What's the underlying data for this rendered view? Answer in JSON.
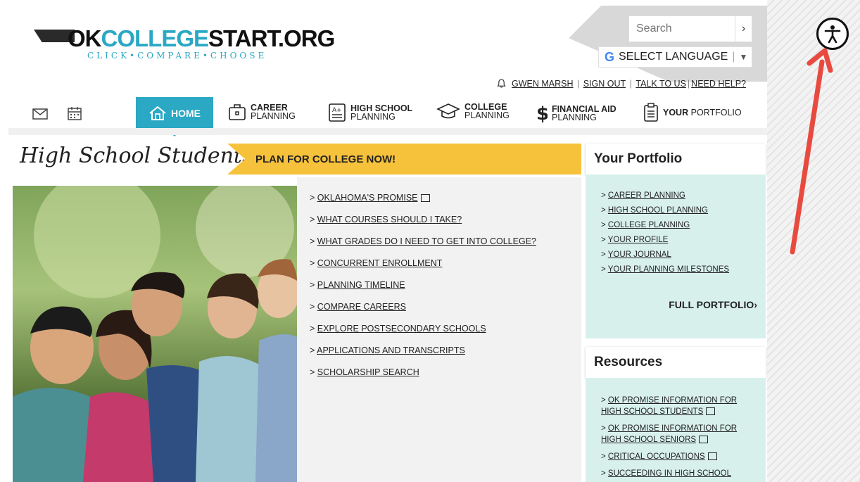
{
  "logo": {
    "part1": "OK",
    "part2": "COLLEGE",
    "part3": "START.ORG",
    "tagline": "CLICK•COMPARE•CHOOSE"
  },
  "search": {
    "placeholder": "Search",
    "button": "›"
  },
  "language": {
    "label": "SELECT LANGUAGE",
    "g": "G",
    "sep": "|",
    "arrow": "▼"
  },
  "user_links": {
    "user": "GWEN MARSH",
    "sign_out": "SIGN OUT",
    "talk": "TALK TO US",
    "help": "NEED HELP?",
    "pipe": "|"
  },
  "nav": {
    "home": "HOME",
    "career_bold": "CAREER",
    "career_rest": "PLANNING",
    "hs_bold": "HIGH SCHOOL",
    "hs_rest": "PLANNING",
    "college_bold": "COLLEGE",
    "college_rest": "PLANNING",
    "fin_bold": "FINANCIAL AID",
    "fin_rest": "PLANNING",
    "your_bold": "YOUR",
    "your_rest": "PORTFOLIO"
  },
  "hero": {
    "script_title": "High School Students",
    "banner": "PLAN FOR COLLEGE NOW!"
  },
  "links": [
    {
      "prefix": ">",
      "label": "OKLAHOMA'S PROMISE"
    },
    {
      "prefix": ">",
      "label": "WHAT COURSES SHOULD I TAKE?"
    },
    {
      "prefix": ">",
      "label": "WHAT GRADES DO I NEED TO GET INTO COLLEGE?"
    },
    {
      "prefix": ">",
      "label": "CONCURRENT ENROLLMENT"
    },
    {
      "prefix": ">",
      "label": "PLANNING TIMELINE"
    },
    {
      "prefix": ">",
      "label": "COMPARE CAREERS"
    },
    {
      "prefix": ">",
      "label": "EXPLORE POSTSECONDARY SCHOOLS"
    },
    {
      "prefix": ">",
      "label": "APPLICATIONS AND TRANSCRIPTS"
    },
    {
      "prefix": ">",
      "label": "SCHOLARSHIP SEARCH"
    }
  ],
  "portfolio": {
    "title": "Your Portfolio",
    "items": [
      {
        "prefix": ">",
        "label": "CAREER PLANNING"
      },
      {
        "prefix": ">",
        "label": "HIGH SCHOOL PLANNING"
      },
      {
        "prefix": ">",
        "label": "COLLEGE PLANNING"
      },
      {
        "prefix": ">",
        "label": "YOUR PROFILE"
      },
      {
        "prefix": ">",
        "label": "YOUR JOURNAL"
      },
      {
        "prefix": ">",
        "label": "YOUR PLANNING MILESTONES"
      }
    ],
    "full": "FULL PORTFOLIO",
    "full_arrow": "›"
  },
  "resources": {
    "title": "Resources",
    "items": [
      {
        "prefix": ">",
        "label": "OK PROMISE INFORMATION FOR HIGH SCHOOL STUDENTS"
      },
      {
        "prefix": ">",
        "label": "OK PROMISE INFORMATION FOR HIGH SCHOOL SENIORS"
      },
      {
        "prefix": ">",
        "label": "CRITICAL OCCUPATIONS"
      },
      {
        "prefix": ">",
        "label": "SUCCEEDING IN HIGH SCHOOL"
      }
    ]
  },
  "colors": {
    "teal": "#2aa8c4",
    "yellow": "#f7c23b",
    "mint": "#d8f0ec",
    "arrow": "#e84a3f"
  },
  "icons": {
    "mail": "mail-icon",
    "calendar": "calendar-icon",
    "home": "home-icon",
    "career": "briefcase-icon",
    "hs": "grades-icon",
    "college": "graduation-cap-icon",
    "fin": "dollar-icon",
    "portfolio": "clipboard-icon",
    "bell": "bell-icon",
    "accessibility": "accessibility-icon",
    "external": "external-link-icon"
  }
}
